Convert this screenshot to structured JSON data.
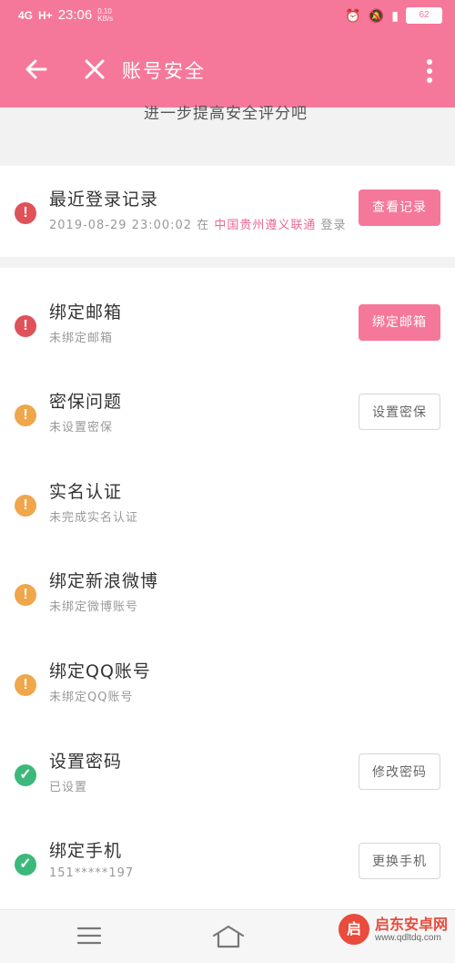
{
  "status_bar": {
    "signal": "4G",
    "signal2": "H+",
    "time": "23:06",
    "speed_value": "0.10",
    "speed_unit": "KB/s",
    "battery": "62"
  },
  "toolbar": {
    "title": "账号安全"
  },
  "tip": {
    "text": "进一步提高安全评分吧"
  },
  "login_record": {
    "title": "最近登录记录",
    "datetime": "2019-08-29 23:00:02",
    "at": "在",
    "location": "中国贵州遵义联通",
    "suffix": "登录",
    "button": "查看记录"
  },
  "items": [
    {
      "title": "绑定邮箱",
      "sub": "未绑定邮箱",
      "status": "red",
      "button": "绑定邮箱",
      "button_style": "pink"
    },
    {
      "title": "密保问题",
      "sub": "未设置密保",
      "status": "orange",
      "button": "设置密保",
      "button_style": "outline"
    },
    {
      "title": "实名认证",
      "sub": "未完成实名认证",
      "status": "orange",
      "button": "",
      "button_style": ""
    },
    {
      "title": "绑定新浪微博",
      "sub": "未绑定微博账号",
      "status": "orange",
      "button": "",
      "button_style": ""
    },
    {
      "title": "绑定QQ账号",
      "sub": "未绑定QQ账号",
      "status": "orange",
      "button": "",
      "button_style": ""
    },
    {
      "title": "设置密码",
      "sub": "已设置",
      "status": "green",
      "button": "修改密码",
      "button_style": "outline"
    },
    {
      "title": "绑定手机",
      "sub": "151*****197",
      "status": "green",
      "button": "更换手机",
      "button_style": "outline"
    }
  ],
  "watermark": {
    "name": "启东安卓网",
    "url": "www.qdltdq.com"
  },
  "colors": {
    "brand": "#f5789a",
    "danger": "#e0525a",
    "warning": "#f0a64a",
    "success": "#3cb97a"
  }
}
